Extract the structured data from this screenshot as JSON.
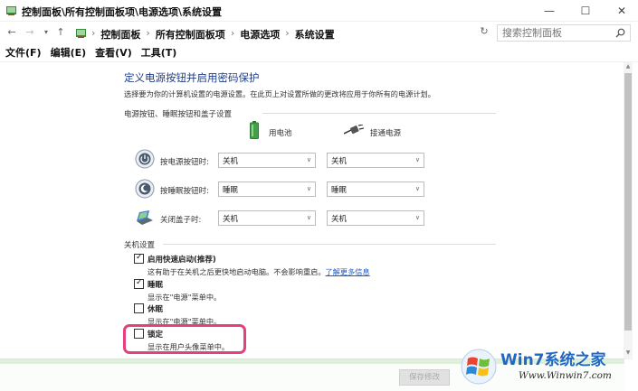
{
  "window": {
    "title": "控制面板\\所有控制面板项\\电源选项\\系统设置",
    "min_glyph": "—",
    "max_glyph": "☐",
    "close_glyph": "✕"
  },
  "nav": {
    "back_glyph": "←",
    "forward_glyph": "→",
    "dropdown_glyph": "▾",
    "up_glyph": "↑",
    "breadcrumbs": [
      "控制面板",
      "所有控制面板项",
      "电源选项",
      "系统设置"
    ],
    "sep_glyph": "›",
    "chevron_glyph": "∨",
    "refresh_glyph": "↻"
  },
  "search": {
    "placeholder": "搜索控制面板"
  },
  "menu": [
    "文件(F)",
    "编辑(E)",
    "查看(V)",
    "工具(T)"
  ],
  "page": {
    "heading": "定义电源按钮并启用密码保护",
    "description": "选择要为你的计算机设置的电源设置。在此页上对设置所做的更改将应用于你所有的电源计划。"
  },
  "power_section": {
    "title": "电源按钮、睡眠按钮和盖子设置",
    "col_battery": "用电池",
    "col_plugged": "接通电源",
    "rows": [
      {
        "label": "按电源按钮时:",
        "battery": "关机",
        "plugged": "关机"
      },
      {
        "label": "按睡眠按钮时:",
        "battery": "睡眠",
        "plugged": "睡眠"
      },
      {
        "label": "关闭盖子时:",
        "battery": "关机",
        "plugged": "关机"
      }
    ],
    "arrow_glyph": "∨"
  },
  "shutdown_section": {
    "title": "关机设置",
    "check_glyph": "✓",
    "items": [
      {
        "label": "启用快速启动(推荐)",
        "desc": "这有助于在关机之后更快地启动电脑。不会影响重启。",
        "link": "了解更多信息",
        "checked": true
      },
      {
        "label": "睡眠",
        "desc": "显示在\"电源\"菜单中。",
        "checked": true
      },
      {
        "label": "休眠",
        "desc": "显示在\"电源\"菜单中。",
        "checked": false
      },
      {
        "label": "锁定",
        "desc": "显示在用户头像菜单中。",
        "checked": false
      }
    ]
  },
  "footer": {
    "save_label": "保存修改"
  },
  "watermark": {
    "title": "Win7系统之家",
    "url": "Www.Winwin7.com"
  },
  "scroll": {
    "up_glyph": "▲",
    "down_glyph": "▼"
  },
  "colors": {
    "heading": "#1e3d8a",
    "link": "#1a5bd0",
    "highlight": "#e4407e",
    "watermark": "#2168c4"
  }
}
